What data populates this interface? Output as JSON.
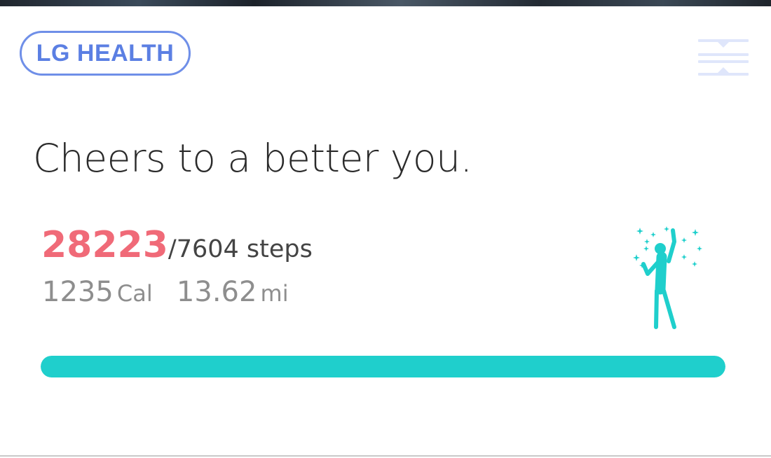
{
  "brand": {
    "label": "LG HEALTH",
    "color": "#5b7fe3"
  },
  "header": {
    "menu_icon": "collapse-menu-icon"
  },
  "headline": "Cheers to a better you.",
  "steps": {
    "count": "28223",
    "goal": "/7604",
    "unit": " steps",
    "count_color": "#f06a78"
  },
  "stats": {
    "calories_value": "1235",
    "calories_unit": "Cal",
    "distance_value": "13.62",
    "distance_unit": "mi"
  },
  "illustration": {
    "icon": "celebrating-person-icon",
    "color": "#1fcfcc"
  },
  "progress": {
    "fraction": 1.0,
    "color": "#1fcfcc"
  }
}
